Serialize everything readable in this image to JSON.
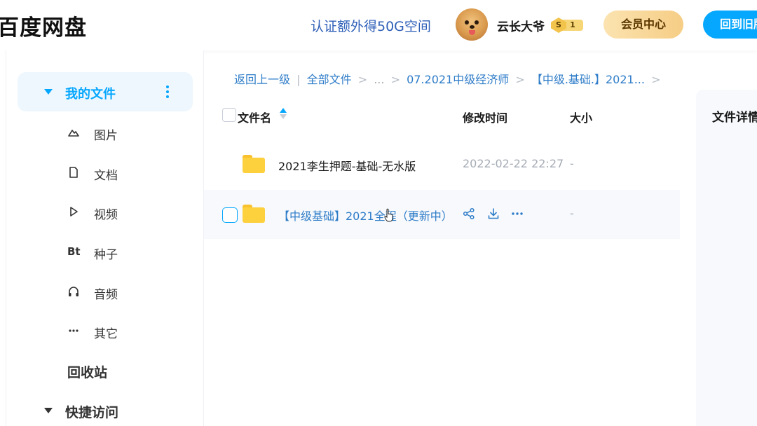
{
  "header": {
    "logo": "百度网盘",
    "promo": "认证额外得50G空间",
    "username": "云长大爷",
    "badge_letter": "S",
    "badge_level": "1",
    "vip_button": "会员中心",
    "back_old_button": "回到旧版"
  },
  "sidebar": {
    "active": "我的文件",
    "items": [
      {
        "icon": "image-icon",
        "label": "图片"
      },
      {
        "icon": "document-icon",
        "label": "文档"
      },
      {
        "icon": "video-icon",
        "label": "视频"
      },
      {
        "icon": "bt-icon",
        "label": "种子"
      },
      {
        "icon": "headphones-icon",
        "label": "音频"
      },
      {
        "icon": "more-icon",
        "label": "其它"
      }
    ],
    "recycle": "回收站",
    "quick_access": "快捷访问"
  },
  "breadcrumb": {
    "back": "返回上一级",
    "all_files": "全部文件",
    "ellipsis": "...",
    "folder1": "07.2021中级经济师",
    "folder2": "【中级.基础.】2021..."
  },
  "table": {
    "headers": {
      "name": "文件名",
      "modified": "修改时间",
      "size": "大小"
    },
    "rows": [
      {
        "name": "2021李生押题-基础-无水版",
        "modified": "2022-02-22 22:27",
        "size": "-"
      },
      {
        "name": "【中级基础】2021全程（更新中）",
        "modified": "",
        "size": "-"
      }
    ]
  },
  "detail": {
    "title": "文件详情"
  },
  "colors": {
    "accent": "#06a7ff",
    "link": "#2e7cc8",
    "folder": "#fdd03d"
  }
}
